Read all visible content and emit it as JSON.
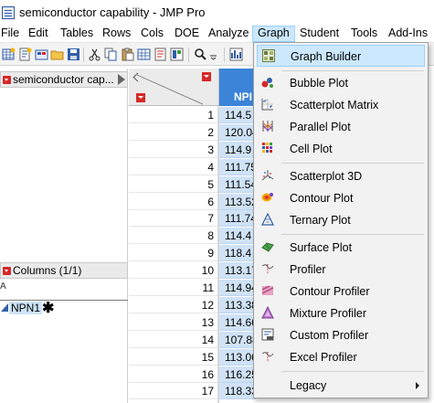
{
  "window": {
    "title": "semiconductor capability - JMP Pro"
  },
  "menubar": {
    "items": [
      {
        "label": "File"
      },
      {
        "label": "Edit"
      },
      {
        "label": "Tables"
      },
      {
        "label": "Rows"
      },
      {
        "label": "Cols"
      },
      {
        "label": "DOE"
      },
      {
        "label": "Analyze"
      },
      {
        "label": "Graph"
      },
      {
        "label": "Student"
      },
      {
        "label": "Tools"
      },
      {
        "label": "Add-Ins"
      }
    ],
    "active": "Graph"
  },
  "left_panel": {
    "table_header": "semiconductor cap...",
    "columns_header": "Columns (1/1)",
    "search_glyph": "A",
    "column_name": "NPN1",
    "column_marker": "✱"
  },
  "grid": {
    "column_header": "NPI",
    "rows": [
      {
        "n": "1",
        "v": "114.5"
      },
      {
        "n": "2",
        "v": "120.04"
      },
      {
        "n": "3",
        "v": "114.9"
      },
      {
        "n": "4",
        "v": "111.75"
      },
      {
        "n": "5",
        "v": "111.54"
      },
      {
        "n": "6",
        "v": "113.52"
      },
      {
        "n": "7",
        "v": "111.74"
      },
      {
        "n": "8",
        "v": "114.4"
      },
      {
        "n": "9",
        "v": "118.4"
      },
      {
        "n": "10",
        "v": "113.17"
      },
      {
        "n": "11",
        "v": "114.94"
      },
      {
        "n": "12",
        "v": "113.38"
      },
      {
        "n": "13",
        "v": "114.66"
      },
      {
        "n": "14",
        "v": "107.88"
      },
      {
        "n": "15",
        "v": "113.06"
      },
      {
        "n": "16",
        "v": "116.25"
      },
      {
        "n": "17",
        "v": "118.33"
      }
    ]
  },
  "graph_menu": {
    "items": [
      {
        "label": "Graph Builder",
        "icon": "graph-builder-icon"
      },
      {
        "label": "Bubble Plot",
        "icon": "bubble-plot-icon"
      },
      {
        "label": "Scatterplot Matrix",
        "icon": "scatterplot-matrix-icon"
      },
      {
        "label": "Parallel Plot",
        "icon": "parallel-plot-icon"
      },
      {
        "label": "Cell Plot",
        "icon": "cell-plot-icon"
      },
      {
        "label": "Scatterplot 3D",
        "icon": "scatterplot-3d-icon"
      },
      {
        "label": "Contour Plot",
        "icon": "contour-plot-icon"
      },
      {
        "label": "Ternary Plot",
        "icon": "ternary-plot-icon"
      },
      {
        "label": "Surface Plot",
        "icon": "surface-plot-icon"
      },
      {
        "label": "Profiler",
        "icon": "profiler-icon"
      },
      {
        "label": "Contour Profiler",
        "icon": "contour-profiler-icon"
      },
      {
        "label": "Mixture Profiler",
        "icon": "mixture-profiler-icon"
      },
      {
        "label": "Custom Profiler",
        "icon": "custom-profiler-icon"
      },
      {
        "label": "Excel Profiler",
        "icon": "excel-profiler-icon"
      },
      {
        "label": "Legacy",
        "icon": ""
      }
    ]
  },
  "colors": {
    "accent": "#3b84d8",
    "menu_highlight": "#cce8ff",
    "disclosure_red": "#d62828"
  }
}
